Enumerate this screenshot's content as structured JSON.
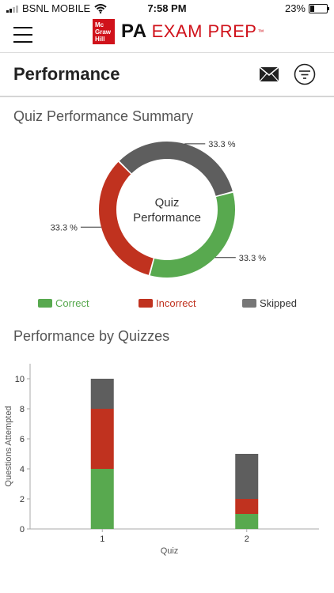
{
  "status_bar": {
    "carrier": "BSNL MOBILE",
    "time": "7:58 PM",
    "battery": "23%",
    "battery_level": 0.23
  },
  "header": {
    "logo_lines": [
      "Mc",
      "Graw",
      "Hill"
    ],
    "brand_pa": "PA",
    "brand_exam": "EXAM PREP",
    "brand_tm": "™"
  },
  "page": {
    "title": "Performance"
  },
  "icons": {
    "menu": "hamburger-menu-icon",
    "mail": "mail-icon",
    "filter": "filter-icon"
  },
  "colors": {
    "correct": "#58a94f",
    "incorrect": "#c0321f",
    "skipped": "#5e5e5e",
    "brand_red": "#d0121b"
  },
  "summary": {
    "title": "Quiz Performance Summary",
    "center_label_line1": "Quiz",
    "center_label_line2": "Performance"
  },
  "legend": {
    "correct": "Correct",
    "incorrect": "Incorrect",
    "skipped": "Skipped"
  },
  "quizzes": {
    "title": "Performance by Quizzes"
  },
  "chart_data": [
    {
      "type": "pie",
      "labels": [
        "Skipped",
        "Correct",
        "Incorrect"
      ],
      "values": [
        33.3,
        33.3,
        33.3
      ],
      "value_labels": [
        "33.3 %",
        "33.3 %",
        "33.3 %"
      ],
      "colors": [
        "#5e5e5e",
        "#58a94f",
        "#c0321f"
      ]
    },
    {
      "type": "bar",
      "stacked": true,
      "categories": [
        "1",
        "2"
      ],
      "series": [
        {
          "name": "Correct",
          "values": [
            4,
            1
          ],
          "color": "#58a94f"
        },
        {
          "name": "Incorrect",
          "values": [
            4,
            1
          ],
          "color": "#c0321f"
        },
        {
          "name": "Skipped",
          "values": [
            2,
            3
          ],
          "color": "#5e5e5e"
        }
      ],
      "xlabel": "Quiz",
      "ylabel": "Questions Attempted",
      "ylim": [
        0,
        11
      ],
      "yticks": [
        "0",
        "2",
        "4",
        "6",
        "8",
        "10"
      ]
    }
  ]
}
